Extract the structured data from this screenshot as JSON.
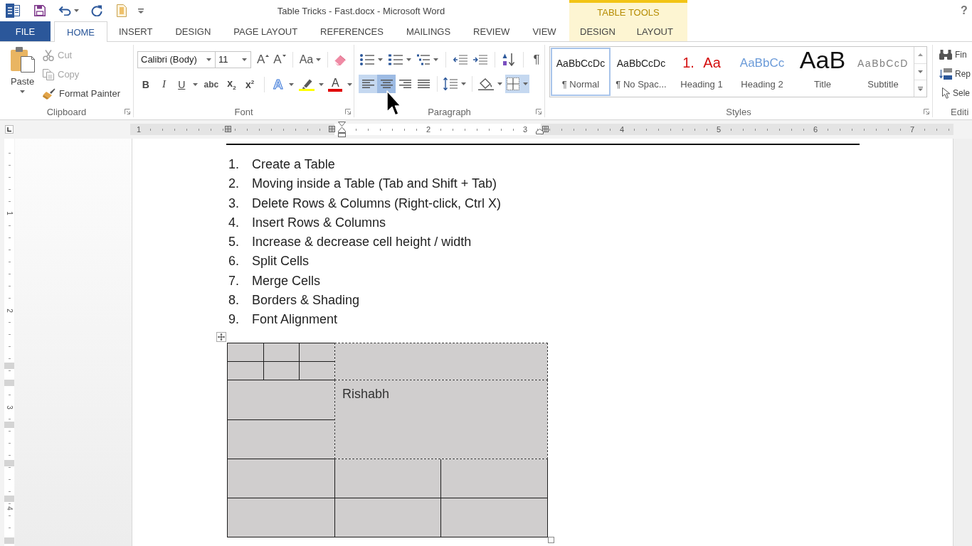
{
  "title_bar": {
    "title": "Table Tricks - Fast.docx - Microsoft Word",
    "contextual_header": "TABLE TOOLS",
    "help": "?"
  },
  "tabs": [
    {
      "label": "FILE",
      "kind": "file",
      "selected": false
    },
    {
      "label": "HOME",
      "kind": "standard",
      "selected": true
    },
    {
      "label": "INSERT",
      "kind": "standard",
      "selected": false
    },
    {
      "label": "DESIGN",
      "kind": "standard",
      "selected": false
    },
    {
      "label": "PAGE LAYOUT",
      "kind": "standard",
      "selected": false
    },
    {
      "label": "REFERENCES",
      "kind": "standard",
      "selected": false
    },
    {
      "label": "MAILINGS",
      "kind": "standard",
      "selected": false
    },
    {
      "label": "REVIEW",
      "kind": "standard",
      "selected": false
    },
    {
      "label": "VIEW",
      "kind": "standard",
      "selected": false
    },
    {
      "label": "DESIGN",
      "kind": "contextual",
      "selected": false
    },
    {
      "label": "LAYOUT",
      "kind": "contextual",
      "selected": false
    }
  ],
  "ribbon": {
    "clipboard": {
      "paste": "Paste",
      "commands": [
        {
          "label": "Cut",
          "kind": "cut",
          "disabled": true
        },
        {
          "label": "Copy",
          "kind": "copy",
          "disabled": true
        },
        {
          "label": "Format Painter",
          "kind": "format_painter",
          "disabled": false
        }
      ],
      "label": "Clipboard"
    },
    "font": {
      "font_name": "Calibri (Body)",
      "font_size": "11",
      "grow_font": "A",
      "shrink_font": "A",
      "change_case": "Aa",
      "formatting": [
        {
          "label": "B",
          "kind": "bold"
        },
        {
          "label": "I",
          "kind": "italic"
        },
        {
          "label": "U",
          "kind": "underline"
        },
        {
          "label": "abc",
          "kind": "strikethrough"
        },
        {
          "label": "x$_{2}$",
          "kind": "subscript"
        },
        {
          "label": "x$^{2}$",
          "kind": "superscript"
        }
      ],
      "text_effects": "A",
      "font_color": "A",
      "label": "Font"
    },
    "paragraph": {
      "show_marks": "¶",
      "alignment": [
        {
          "kind": "left",
          "selected": true,
          "hovered": false
        },
        {
          "kind": "center",
          "selected": true,
          "hovered": true
        },
        {
          "kind": "right",
          "selected": false,
          "hovered": false
        },
        {
          "kind": "justify",
          "selected": false,
          "hovered": false
        }
      ],
      "borders": {
        "selected": true
      },
      "label": "Paragraph"
    },
    "styles": {
      "items": [
        {
          "preview": "AaBbCcDc",
          "name": "¶ Normal",
          "kind": "normal",
          "selected": true
        },
        {
          "preview": "AaBbCcDc",
          "name": "¶ No Spac...",
          "kind": "no_spacing",
          "selected": false
        },
        {
          "preview": "1. Aa",
          "name": "Heading 1",
          "kind": "heading1",
          "selected": false
        },
        {
          "preview": "AaBbCc",
          "name": "Heading 2",
          "kind": "heading2",
          "selected": false
        },
        {
          "preview": "AaB",
          "name": "Title",
          "kind": "title",
          "selected": false
        },
        {
          "preview": "AaBbCcD",
          "name": "Subtitle",
          "kind": "subtitle",
          "selected": false
        }
      ],
      "label": "Styles"
    },
    "editing": {
      "commands": [
        {
          "label": "Fin",
          "kind": "find"
        },
        {
          "label": "Rep",
          "kind": "replace"
        },
        {
          "label": "Sele",
          "kind": "select"
        }
      ],
      "label": "Editi"
    }
  },
  "rulers": {
    "horizontal": [
      "1",
      "2",
      "3",
      "4",
      "5",
      "6",
      "7"
    ],
    "vertical": [
      "1",
      "2",
      "3",
      "4"
    ]
  },
  "document": {
    "list": [
      {
        "number": "1.",
        "text": "Create a Table"
      },
      {
        "number": "2.",
        "text": "Moving inside a Table (Tab and Shift + Tab)"
      },
      {
        "number": "3.",
        "text": "Delete Rows & Columns (Right-click, Ctrl X)"
      },
      {
        "number": "4.",
        "text": "Insert Rows & Columns"
      },
      {
        "number": "5.",
        "text": "Increase & decrease cell height / width"
      },
      {
        "number": "6.",
        "text": "Split Cells"
      },
      {
        "number": "7.",
        "text": "Merge Cells"
      },
      {
        "number": "8.",
        "text": "Borders & Shading"
      },
      {
        "number": "9.",
        "text": "Font Alignment"
      }
    ],
    "table": {
      "cells": [
        {
          "kind": "bordered"
        },
        {
          "kind": "bordered"
        },
        {
          "kind": "bordered"
        },
        {
          "kind": "gridline"
        },
        {
          "kind": "bordered"
        },
        {
          "kind": "bordered"
        },
        {
          "kind": "bordered"
        },
        {
          "kind": "bordered"
        },
        {
          "kind": "gridline",
          "text": "Rishabh"
        },
        {
          "kind": "bordered"
        },
        {
          "kind": "bordered"
        },
        {
          "kind": "bordered"
        },
        {
          "kind": "bordered"
        },
        {
          "kind": "bordered"
        },
        {
          "kind": "bordered"
        },
        {
          "kind": "bordered"
        }
      ]
    }
  }
}
